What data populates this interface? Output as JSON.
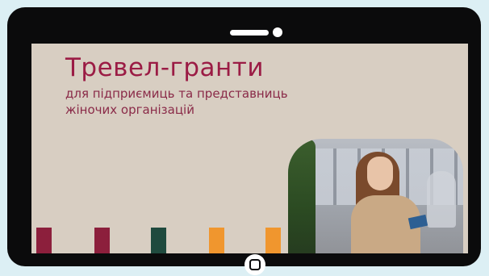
{
  "banner": {
    "title": "Тревел-гранти",
    "subtitle_line1": "для підприємиць та представниць",
    "subtitle_line2": "жіночих організацій"
  },
  "colors": {
    "page_background": "#dceff4",
    "device_frame": "#0b0b0c",
    "screen_background": "#d8cec2",
    "title_color": "#9b1c45",
    "bottle_colors": [
      "#8c1f3c",
      "#8c1f3c",
      "#1f4a3e",
      "#f0962e",
      "#f0962e"
    ]
  },
  "icons": {
    "speaker": "speaker-icon",
    "camera": "camera-icon",
    "home": "home-button-icon"
  }
}
